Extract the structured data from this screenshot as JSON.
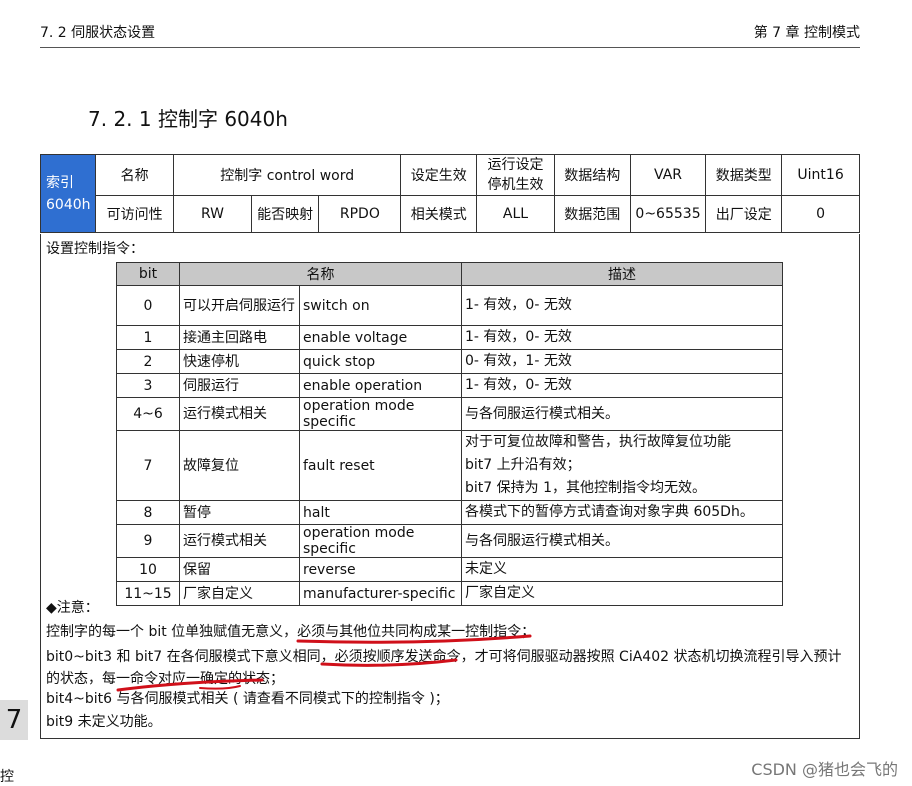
{
  "header": {
    "left": "7. 2  伺服状态设置",
    "right": "第 7 章  控制模式"
  },
  "section_title": "7. 2. 1 控制字 6040h",
  "attr": {
    "index_label": "索引",
    "index_value": "6040h",
    "row1": [
      "名称",
      "控制字 control word",
      "设定生效",
      "运行设定停机生效",
      "数据结构",
      "VAR",
      "数据类型",
      "Uint16"
    ],
    "row2": [
      "可访问性",
      "RW",
      "能否映射",
      "RPDO",
      "相关模式",
      "ALL",
      "数据范围",
      "0~65535",
      "出厂设定",
      "0"
    ]
  },
  "intro": "设置控制指令：",
  "bit_table": {
    "headers": [
      "bit",
      "名称",
      "描述"
    ],
    "rows": [
      {
        "bit": "0",
        "cn": "可以开启伺服运行",
        "en": "switch on",
        "desc": [
          "1- 有效，0- 无效"
        ]
      },
      {
        "bit": "1",
        "cn": "接通主回路电",
        "en": "enable voltage",
        "desc": [
          "1- 有效，0- 无效"
        ]
      },
      {
        "bit": "2",
        "cn": "快速停机",
        "en": "quick stop",
        "desc": [
          "0- 有效，1- 无效"
        ]
      },
      {
        "bit": "3",
        "cn": "伺服运行",
        "en": "enable operation",
        "desc": [
          "1- 有效，0- 无效"
        ]
      },
      {
        "bit": "4~6",
        "cn": "运行模式相关",
        "en": "operation mode specific",
        "desc": [
          "与各伺服运行模式相关。"
        ]
      },
      {
        "bit": "7",
        "cn": "故障复位",
        "en": "fault reset",
        "desc": [
          "对于可复位故障和警告，执行故障复位功能",
          "bit7 上升沿有效；",
          "bit7 保持为 1，其他控制指令均无效。"
        ]
      },
      {
        "bit": "8",
        "cn": "暂停",
        "en": "halt",
        "desc": [
          "各模式下的暂停方式请查询对象字典 605Dh。"
        ]
      },
      {
        "bit": "9",
        "cn": "运行模式相关",
        "en": "operation mode specific",
        "desc": [
          "与各伺服运行模式相关。"
        ]
      },
      {
        "bit": "10",
        "cn": "保留",
        "en": "reverse",
        "desc": [
          "未定义"
        ]
      },
      {
        "bit": "11~15",
        "cn": "厂家自定义",
        "en": "manufacturer-specific",
        "desc": [
          "厂家自定义"
        ]
      }
    ]
  },
  "notes": {
    "title": "◆注意：",
    "lines": [
      "控制字的每一个 bit 位单独赋值无意义，必须与其他位共同构成某一控制指令；",
      "bit0~bit3 和 bit7 在各伺服模式下意义相同，必须按顺序发送命令，才可将伺服驱动器按照 CiA402 状态机切换流程引导入预计的状态，每一命令对应一确定的状态；",
      "bit4~bit6 与各伺服模式相关 ( 请查看不同模式下的控制指令 )；",
      "bit9 未定义功能。"
    ]
  },
  "side": {
    "chapter": "7",
    "char": "控"
  },
  "watermark": "CSDN @猪也会飞的",
  "colors": {
    "index_bg": "#2f6fd1",
    "table_header_bg": "#c8c8c8",
    "annotation": "#d0101a"
  }
}
